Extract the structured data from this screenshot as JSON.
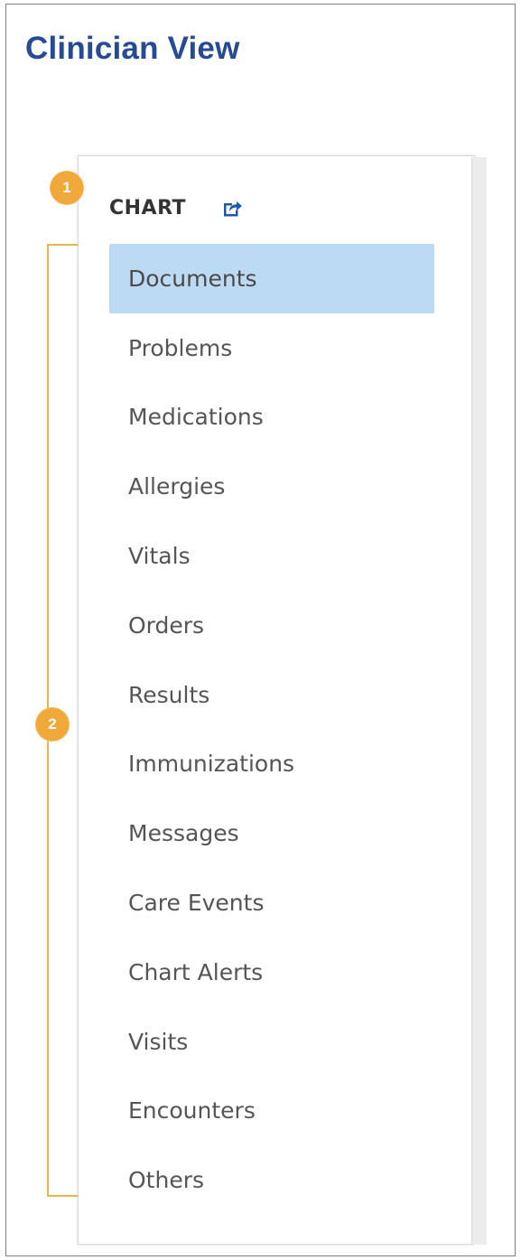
{
  "page": {
    "title": "Clinician View"
  },
  "callouts": [
    "1",
    "2"
  ],
  "chart_nav": {
    "header_label": "CHART",
    "header_icon": "popout-icon",
    "selected_index": 0,
    "items": [
      {
        "label": "Documents"
      },
      {
        "label": "Problems"
      },
      {
        "label": "Medications"
      },
      {
        "label": "Allergies"
      },
      {
        "label": "Vitals"
      },
      {
        "label": "Orders"
      },
      {
        "label": "Results"
      },
      {
        "label": "Immunizations"
      },
      {
        "label": "Messages"
      },
      {
        "label": "Care Events"
      },
      {
        "label": "Chart Alerts"
      },
      {
        "label": "Visits"
      },
      {
        "label": "Encounters"
      },
      {
        "label": "Others"
      }
    ]
  },
  "colors": {
    "title": "#264a94",
    "callout": "#f0a83a",
    "selected_bg": "#bcdaf3",
    "icon": "#1f5aa6"
  }
}
